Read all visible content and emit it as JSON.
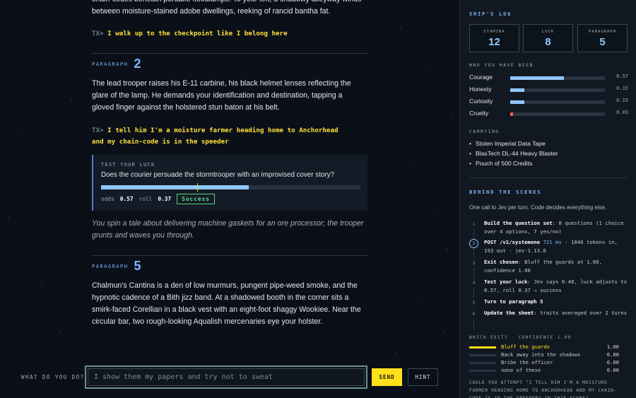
{
  "story": {
    "intro_text": "chain-codes beneath portable floodlamps. To your left, a shadowy alleyway winds between moisture-stained adobe dwellings, reeking of rancid bantha fat.",
    "turns": [
      {
        "prompt": "TX>",
        "text": "I walk up to the checkpoint like I belong here"
      }
    ],
    "paragraph_label": "PARAGRAPH",
    "p2": {
      "number": "2",
      "text": "The lead trooper raises his E-11 carbine, his black helmet lenses reflecting the glare of the lamp. He demands your identification and destination, tapping a gloved finger against the holstered stun baton at his belt.",
      "tx_prompt": "TX>",
      "tx_line1": "I tell him I'm a moisture farmer heading home to Anchorhead",
      "tx_line2": "and my chain-code is in the speeder"
    },
    "luck": {
      "label": "TEST YOUR LUCK",
      "question": "Does the courier persuade the stormtrooper with an improvised cover story?",
      "odds_label": "odds",
      "odds": "0.57",
      "roll_label": "roll",
      "roll": "0.37",
      "odds_fraction": 0.57,
      "roll_fraction": 0.37,
      "result": "Success"
    },
    "outcome": "You spin a tale about delivering machine gaskets for an ore processor; the trooper grunts and waves you through.",
    "p5": {
      "number": "5",
      "text": "Chalmun's Cantina is a den of low murmurs, pungent pipe-weed smoke, and the hypnotic cadence of a Bith jizz band. At a shadowed booth in the corner sits a smirk-faced Corellian in a black vest with an eight-foot shaggy Wookiee. Near the circular bar, two rough-looking Aqualish mercenaries eye your holster."
    }
  },
  "input": {
    "label": "WHAT DO YOU DO?",
    "placeholder": "I show them my papers and try not to sweat",
    "send_label": "SEND",
    "hint_label": "HINT"
  },
  "sidebar": {
    "title": "SHIP'S LOG",
    "stats": [
      {
        "label": "STAMINA",
        "value": "12"
      },
      {
        "label": "LUCK",
        "value": "8"
      },
      {
        "label": "PARAGRAPH",
        "value": "5"
      }
    ],
    "traits_title": "WHO YOU HAVE BEEN",
    "traits": [
      {
        "name": "Courage",
        "value": "0.57",
        "level": 0.57,
        "color": "#8fc7ff"
      },
      {
        "name": "Honesty",
        "value": "0.15",
        "level": 0.15,
        "color": "#8fc7ff"
      },
      {
        "name": "Curiosity",
        "value": "0.15",
        "level": 0.15,
        "color": "#8fc7ff"
      },
      {
        "name": "Cruelty",
        "value": "0.03",
        "level": 0.03,
        "color": "#ff5a4e"
      }
    ],
    "carrying_title": "CARRYING",
    "carrying": [
      "Stolen Imperial Data Tape",
      "BlasTech DL-44 Heavy Blaster",
      "Pouch of 500 Credits"
    ],
    "behind_title": "BEHIND THE SCENES",
    "behind_sub": "One call to Jev per turn. Code decides everything else.",
    "steps": [
      {
        "n": "1",
        "bold": "Build the question set",
        "rest": ": 8 questions (1 choice over 4 options, 7 yes/no)"
      },
      {
        "n": "2",
        "bold": "POST /v1/systemone",
        "ms": "721 ms",
        "rest": " · 1046 tokens in, 193 out · jev-1.13.0"
      },
      {
        "n": "3",
        "bold": "Exit chosen",
        "rest": ": Bluff the guards at 1.00, confidence 1.00"
      },
      {
        "n": "4",
        "bold": "Test your luck",
        "rest": ": Jev says 0.48, luck adjusts to 0.57, roll 0.37 → success"
      },
      {
        "n": "5",
        "bold": "Turn to paragraph 5",
        "rest": ""
      },
      {
        "n": "6",
        "bold": "Update the sheet",
        "rest": ": traits averaged over 2 turns"
      }
    ],
    "exit_title": "WHICH EXIT? · CONFIDENCE 1.00",
    "exits": [
      {
        "label": "Bluff the guards",
        "value": "1.00",
        "level": 1.0
      },
      {
        "label": "Back away into the shadows",
        "value": "0.00",
        "level": 0.0
      },
      {
        "label": "Bribe the officer",
        "value": "0.00",
        "level": 0.0
      },
      {
        "label": "none of these",
        "value": "0.00",
        "level": 0.0
      }
    ],
    "attempt_text": "COULD YOU ATTEMPT \"I TELL HIM I'M A MOISTURE FARMER HEADING HOME TO ANCHORHEAD AND MY CHAIN-CODE IS IN THE SPEEDER\" IN THIS SCENE?"
  }
}
